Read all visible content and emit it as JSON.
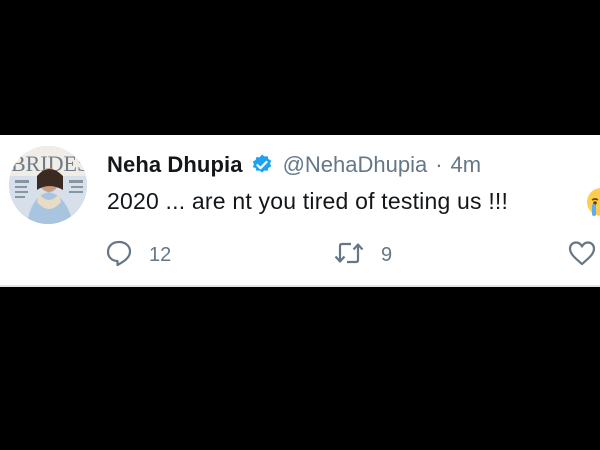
{
  "tweet": {
    "display_name": "Neha Dhupia",
    "handle": "@NehaDhupia",
    "separator": "·",
    "timestamp": "4m",
    "text": "2020 ... are nt you tired of testing us !!!",
    "emoji": "crying-face-emoji",
    "avatar_text": "BRIDES"
  },
  "actions": {
    "reply_icon": "speech-bubble-icon",
    "reply_count": "12",
    "retweet_icon": "retweet-arrows-icon",
    "retweet_count": "9",
    "like_icon": "heart-icon",
    "like_count": ""
  },
  "colors": {
    "background": "#000000",
    "card": "#ffffff",
    "text_primary": "#14171a",
    "text_secondary": "#657786",
    "verified_blue": "#1da1f2",
    "action_icon": "#657786"
  }
}
